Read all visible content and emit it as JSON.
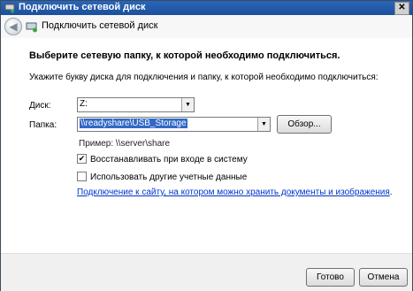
{
  "window": {
    "title": "Подключить сетевой диск",
    "close_label": "✕"
  },
  "nav": {
    "back_label": "◀",
    "title": "Подключить сетевой диск"
  },
  "main": {
    "heading": "Выберите сетевую папку, к которой необходимо подключиться.",
    "description": "Укажите букву диска для подключения и папку, к которой необходимо подключиться:",
    "drive": {
      "label": "Диск:",
      "value": "Z:"
    },
    "folder": {
      "label": "Папка:",
      "value": "\\\\readyshare\\USB_Storage"
    },
    "browse_label": "Обзор...",
    "example": "Пример: \\\\server\\share",
    "reconnect": {
      "label": "Восстанавливать при входе в систему",
      "checked": true
    },
    "other_credentials": {
      "label": "Использовать другие учетные данные",
      "checked": false
    },
    "link_text": "Подключение к сайту, на котором можно хранить документы и изображения",
    "link_suffix": "."
  },
  "footer": {
    "finish_label": "Готово",
    "cancel_label": "Отмена"
  },
  "colors": {
    "titlebar": "#1c4f9c",
    "selection": "#3169c6",
    "link": "#0033cc"
  },
  "icons": {
    "titlebar": "network-drive-icon",
    "back": "back-arrow-icon",
    "nav": "network-drive-icon",
    "dropdown": "chevron-down-icon"
  }
}
